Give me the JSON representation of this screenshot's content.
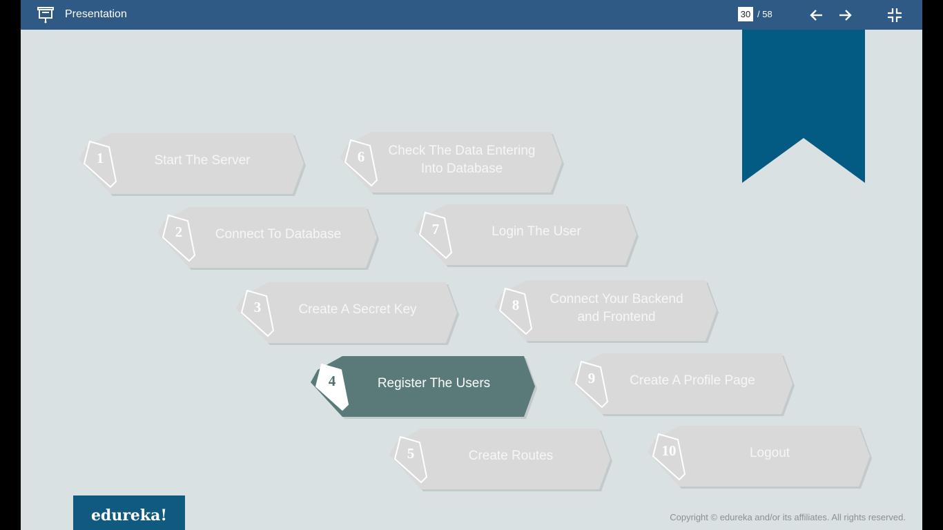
{
  "header": {
    "title": "Presentation",
    "current_page": "30",
    "total_pages": "/ 58",
    "icons": [
      "presentation-icon",
      "arrow-left-icon",
      "arrow-right-icon",
      "exit-fullscreen-icon"
    ]
  },
  "slide": {
    "colors": {
      "background": "#dae1e3",
      "ribbon": "#035a82",
      "active": "#5a7a79",
      "inactive": "#d9d9d9"
    },
    "active_step": "4",
    "steps": [
      {
        "num": "1",
        "label": "Start The Server"
      },
      {
        "num": "2",
        "label": "Connect To Database"
      },
      {
        "num": "3",
        "label": "Create A Secret Key"
      },
      {
        "num": "4",
        "label": "Register The Users"
      },
      {
        "num": "5",
        "label": "Create Routes"
      },
      {
        "num": "6",
        "label": "Check The Data Entering Into Database"
      },
      {
        "num": "7",
        "label": "Login The User"
      },
      {
        "num": "8",
        "label": "Connect Your Backend and Frontend"
      },
      {
        "num": "9",
        "label": "Create A Profile Page"
      },
      {
        "num": "10",
        "label": "Logout"
      }
    ],
    "logo_text": "edureka!",
    "copyright": "Copyright © edureka and/or its affiliates. All rights reserved."
  }
}
